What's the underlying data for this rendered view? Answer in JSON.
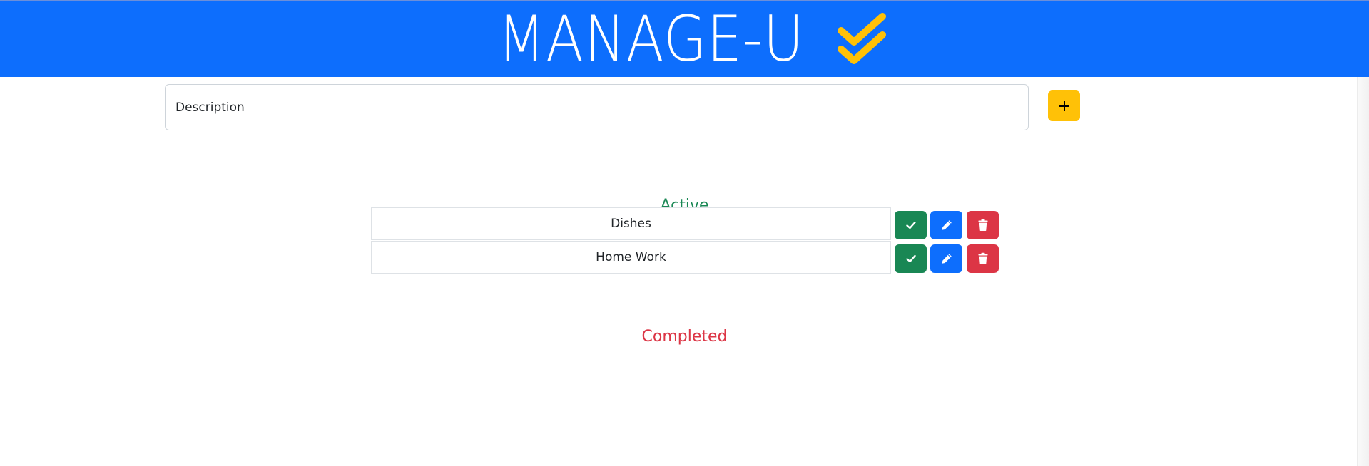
{
  "header": {
    "title": "MANAGE-U",
    "logo_icon": "double-check-icon",
    "background_color": "#0d6efd",
    "logo_color": "#ffc107"
  },
  "new_task": {
    "placeholder": "Description",
    "value": "",
    "add_label": "+",
    "add_icon": "plus-icon"
  },
  "sections": {
    "active_title": "Active",
    "completed_title": "Completed"
  },
  "active_tasks": [
    {
      "description": "Dishes"
    },
    {
      "description": "Home Work"
    }
  ],
  "completed_tasks": [],
  "actions": {
    "complete_icon": "check-icon",
    "edit_icon": "pencil-icon",
    "delete_icon": "trash-icon",
    "colors": {
      "complete": "#198754",
      "edit": "#0d6efd",
      "delete": "#dc3545",
      "active_heading": "#198754",
      "completed_heading": "#dc3545"
    }
  }
}
